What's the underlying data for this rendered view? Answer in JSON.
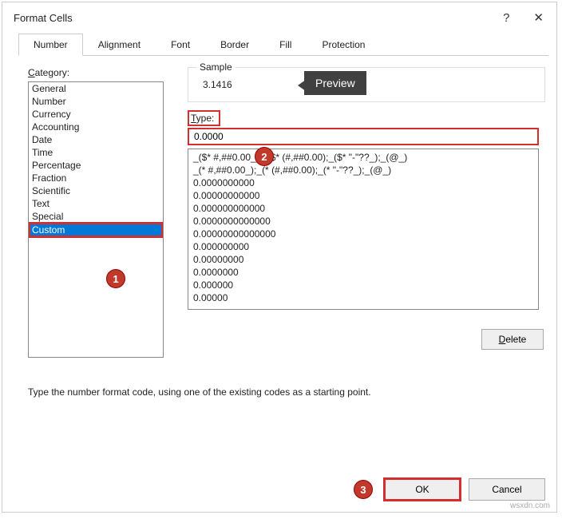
{
  "dialog": {
    "title": "Format Cells"
  },
  "tabs": {
    "number": "Number",
    "alignment": "Alignment",
    "font": "Font",
    "border": "Border",
    "fill": "Fill",
    "protection": "Protection"
  },
  "category": {
    "label_prefix": "C",
    "label_rest": "ategory:",
    "items": [
      "General",
      "Number",
      "Currency",
      "Accounting",
      "Date",
      "Time",
      "Percentage",
      "Fraction",
      "Scientific",
      "Text",
      "Special",
      "Custom"
    ],
    "selected": "Custom"
  },
  "sample": {
    "legend": "Sample",
    "value": "3.1416"
  },
  "type": {
    "label_prefix": "T",
    "label_rest": "ype:",
    "value": "0.0000"
  },
  "format_list": [
    "_($* #,##0.00_);_($* (#,##0.00);_($* \"-\"??_);_(@_)",
    "_(* #,##0.00_);_(* (#,##0.00);_(* \"-\"??_);_(@_)",
    "0.0000000000",
    "0.00000000000",
    "0.000000000000",
    "0.0000000000000",
    "0.00000000000000",
    "0.000000000",
    "0.00000000",
    "0.0000000",
    "0.000000",
    "0.00000"
  ],
  "buttons": {
    "delete": "Delete",
    "ok": "OK",
    "cancel": "Cancel"
  },
  "hint": "Type the number format code, using one of the existing codes as a starting point.",
  "callouts": {
    "preview": "Preview",
    "badge1": "1",
    "badge2": "2",
    "badge3": "3"
  },
  "watermark": "wsxdn.com"
}
